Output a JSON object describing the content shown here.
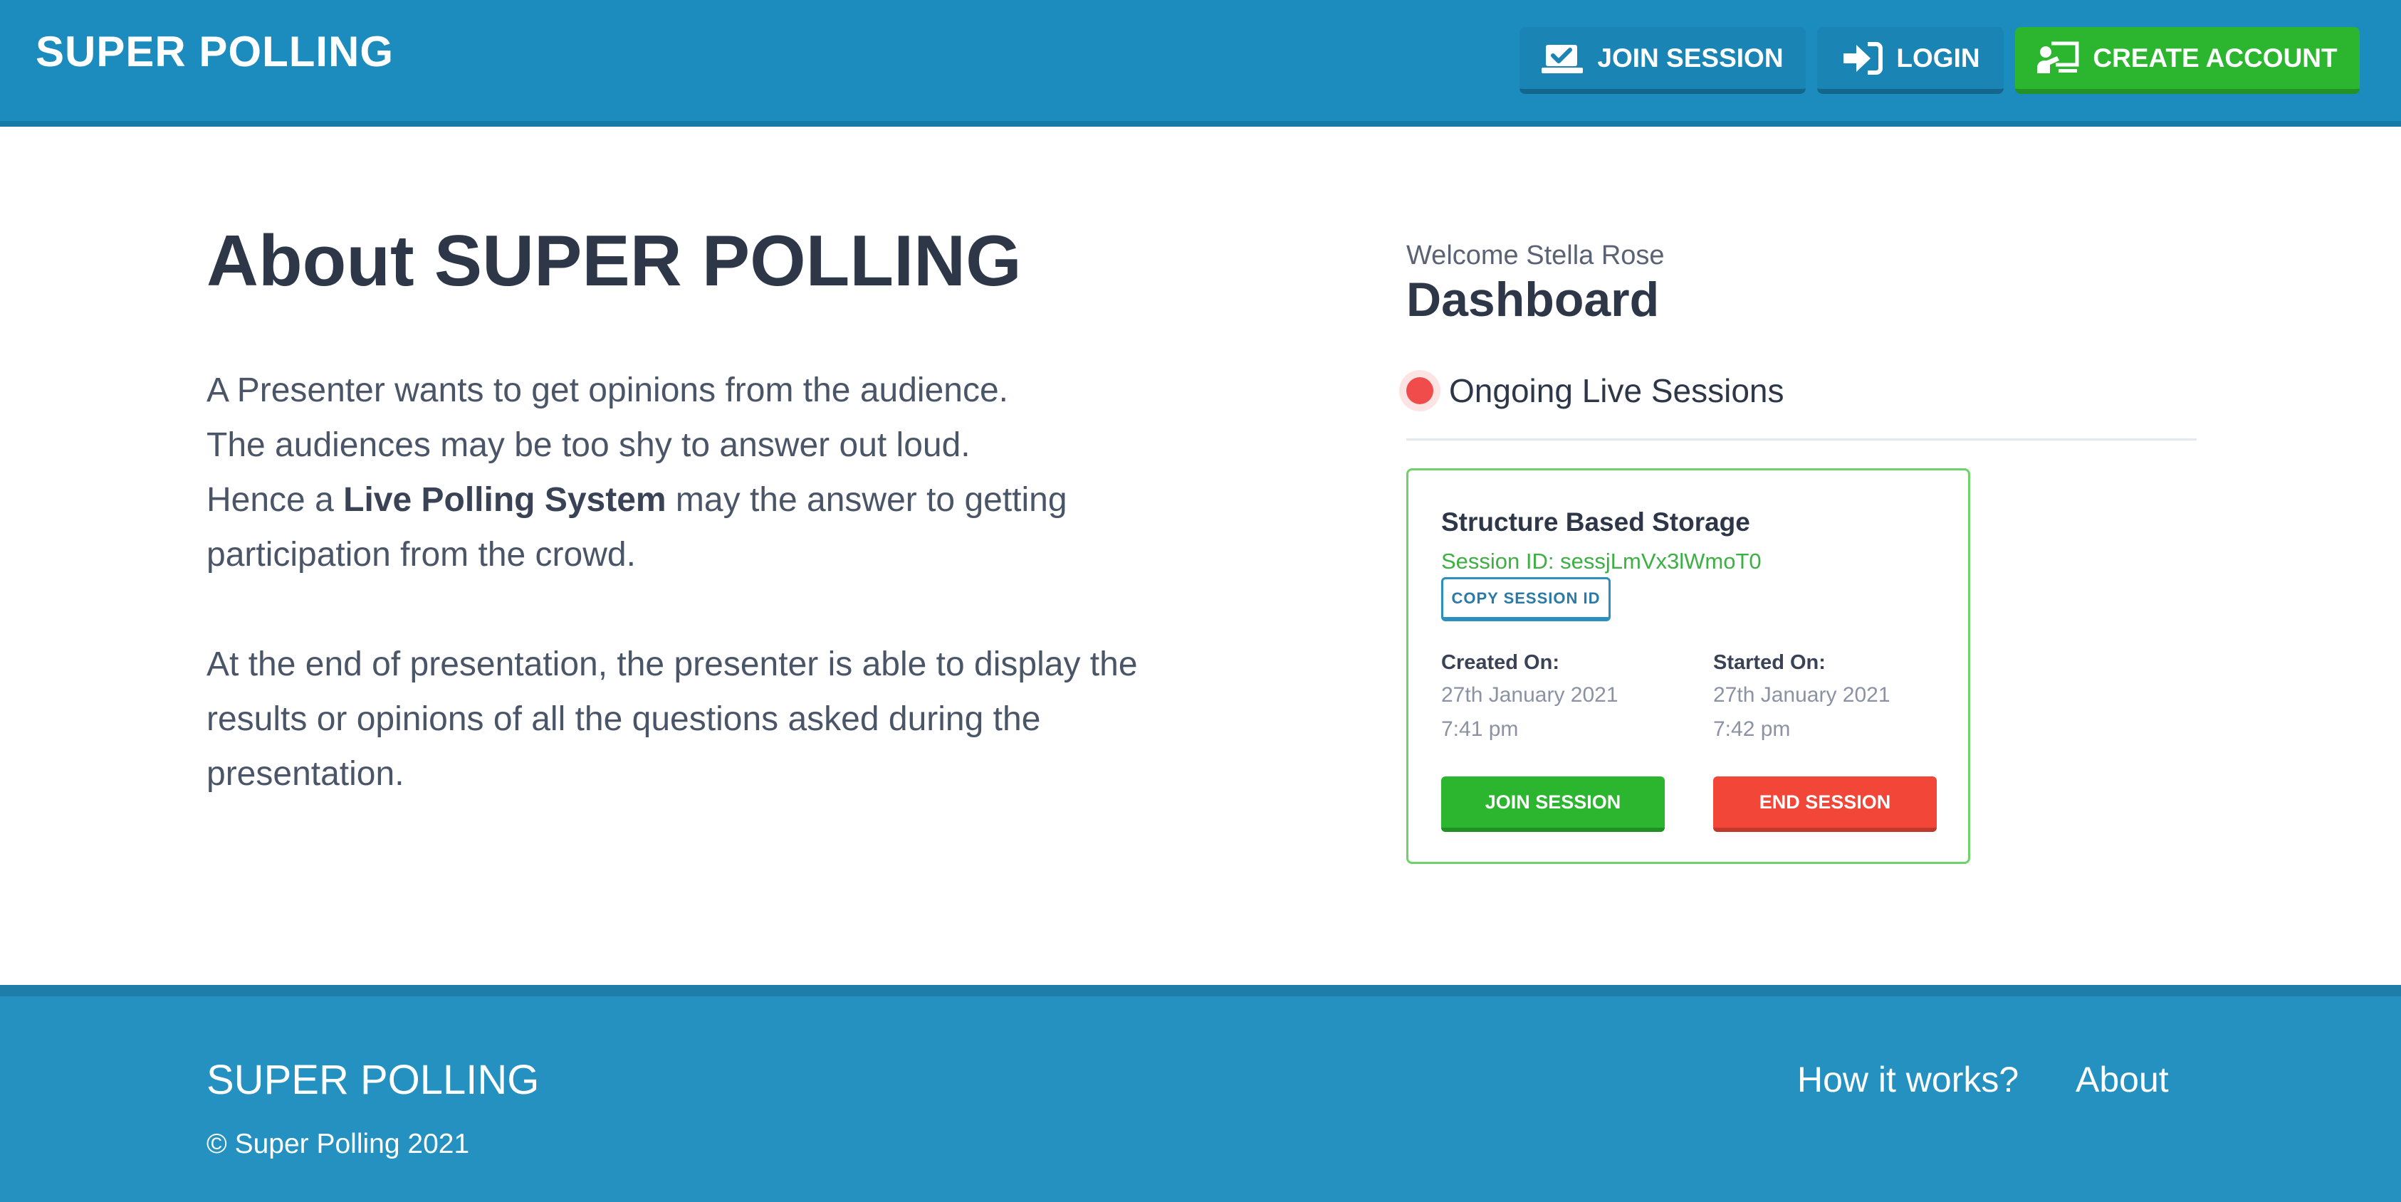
{
  "header": {
    "brand": "SUPER POLLING",
    "buttons": {
      "join_session": "JOIN SESSION",
      "login": "LOGIN",
      "create_account": "CREATE ACCOUNT"
    },
    "icons": {
      "join_session": "checked-box-icon",
      "login": "sign-in-icon",
      "create_account": "presenter-board-icon"
    }
  },
  "about": {
    "title": "About SUPER POLLING",
    "line1": "A Presenter wants to get opinions from the audience.",
    "line2": "The audiences may be too shy to answer out loud.",
    "line3_prefix": "Hence a ",
    "line3_bold": "Live Polling System",
    "line3_suffix": " may the answer to getting participation from the crowd.",
    "para2": "At the end of presentation, the presenter is able to display the results or opinions of all the questions asked during the presentation."
  },
  "dashboard": {
    "welcome": "Welcome Stella Rose",
    "title": "Dashboard",
    "section_heading": "Ongoing Live Sessions",
    "session": {
      "name": "Structure Based Storage",
      "session_id": "Session ID: sessjLmVx3lWmoT0",
      "copy_label": "COPY SESSION ID",
      "created_label": "Created On:",
      "created_date": "27th January 2021",
      "created_time": "7:41 pm",
      "started_label": "Started On:",
      "started_date": "27th January 2021",
      "started_time": "7:42 pm",
      "join_label": "JOIN SESSION",
      "end_label": "END SESSION"
    }
  },
  "footer": {
    "brand": "SUPER POLLING",
    "copyright": "© Super Polling 2021",
    "links": {
      "how": "How it works?",
      "about": "About"
    }
  },
  "colors": {
    "header_bg": "#1b8cbd",
    "footer_bg": "#2491c1",
    "accent_green": "#2cb52f",
    "accent_red": "#f24638",
    "live_dot": "#f04c4c"
  }
}
